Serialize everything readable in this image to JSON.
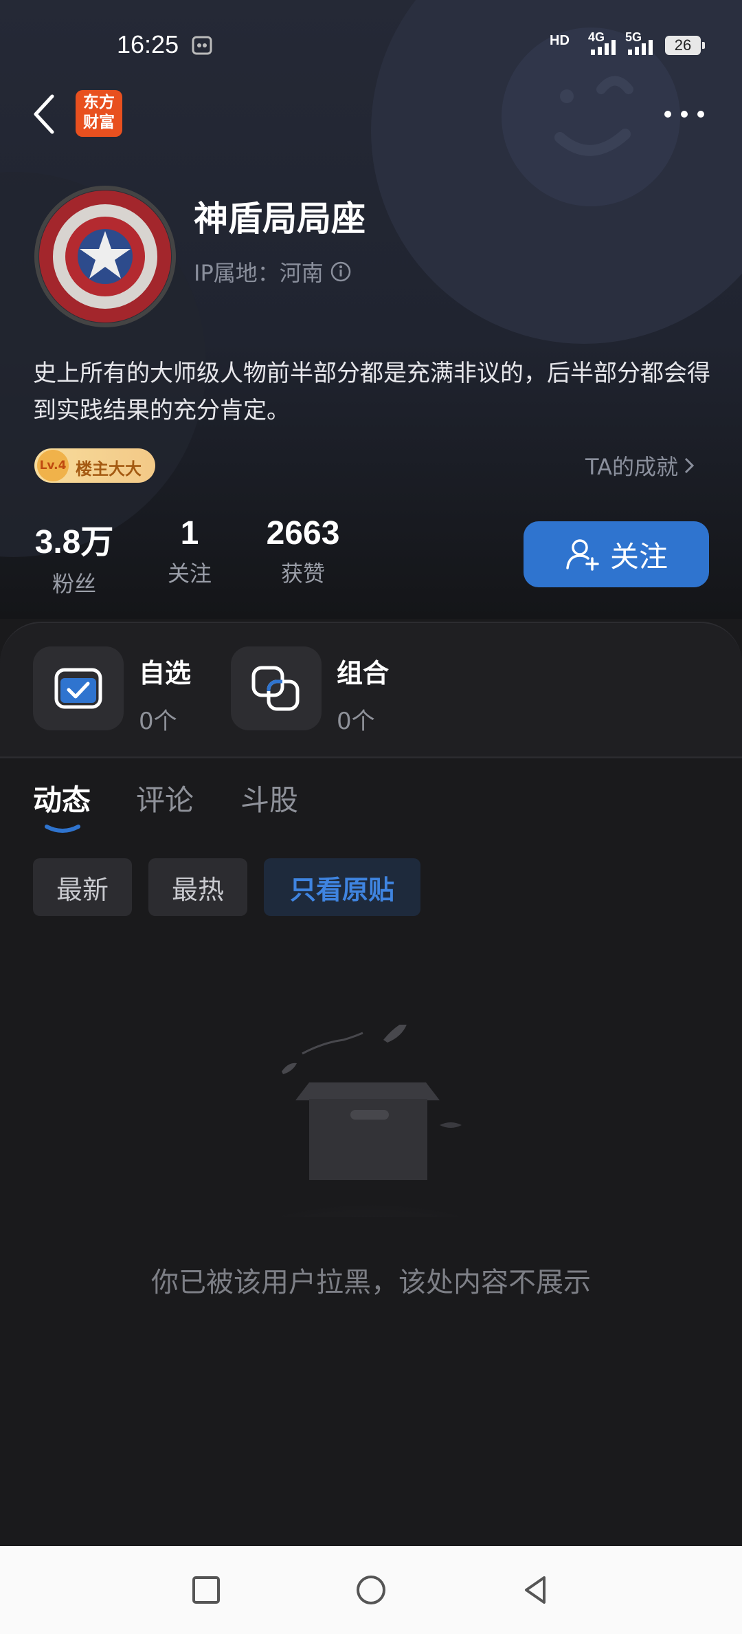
{
  "status_bar": {
    "time": "16:25",
    "battery": "26",
    "network_hd": "HD",
    "network_4g": "4G",
    "network_5g": "5G"
  },
  "header": {
    "app_logo_line1": "东方",
    "app_logo_line2": "财富"
  },
  "profile": {
    "name": "神盾局局座",
    "ip_location": "IP属地：河南",
    "bio": "史上所有的大师级人物前半部分都是充满非议的，后半部分都会得到实践结果的充分肯定。",
    "badge_level": "Lv.4",
    "badge_label": "楼主大大",
    "achievement_link": "TA的成就"
  },
  "stats": [
    {
      "value": "3.8万",
      "label": "粉丝"
    },
    {
      "value": "1",
      "label": "关注"
    },
    {
      "value": "2663",
      "label": "获赞"
    }
  ],
  "follow_button": "关注",
  "tiles": [
    {
      "title": "自选",
      "count": "0个"
    },
    {
      "title": "组合",
      "count": "0个"
    }
  ],
  "tabs": [
    "动态",
    "评论",
    "斗股"
  ],
  "active_tab": "动态",
  "filters": [
    "最新",
    "最热",
    "只看原贴"
  ],
  "active_filter": "只看原贴",
  "empty_message": "你已被该用户拉黑，该处内容不展示",
  "colors": {
    "accent_blue": "#2f74cf",
    "background": "#1a1a1c",
    "logo_orange": "#e8501f"
  }
}
